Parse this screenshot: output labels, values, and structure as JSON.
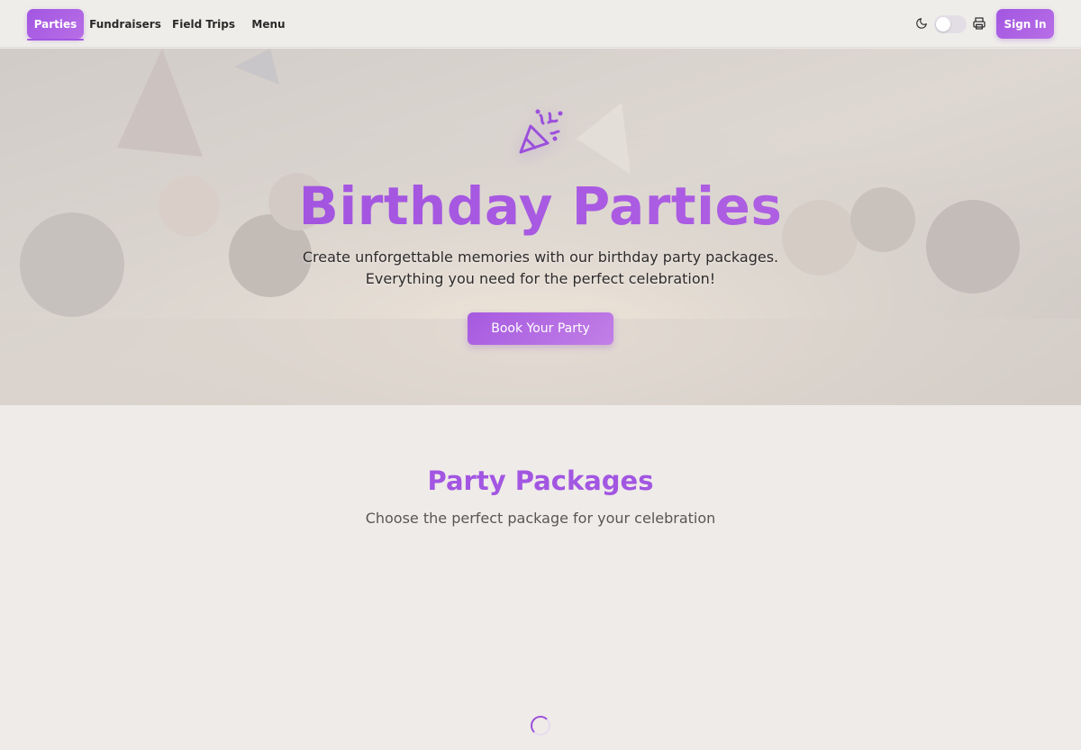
{
  "nav": {
    "items": [
      {
        "label": "Parties",
        "active": true
      },
      {
        "label": "Fundraisers",
        "active": false
      },
      {
        "label": "Field Trips",
        "active": false
      },
      {
        "label": "Menu",
        "active": false
      }
    ],
    "theme_icon": "moon-icon",
    "print_icon": "printer-icon",
    "sign_in_label": "Sign In"
  },
  "hero": {
    "icon": "party-popper-icon",
    "title": "Birthday Parties",
    "subtitle_line1": "Create unforgettable memories with our birthday party packages.",
    "subtitle_line2": "Everything you need for the perfect celebration!",
    "cta_label": "Book Your Party"
  },
  "packages": {
    "title": "Party Packages",
    "subtitle": "Choose the perfect package for your celebration",
    "loading": true
  },
  "colors": {
    "accent": "#a256e2",
    "accent_light": "#b86ee6",
    "background": "#efebe8",
    "text_dark": "#2a2a2a"
  }
}
